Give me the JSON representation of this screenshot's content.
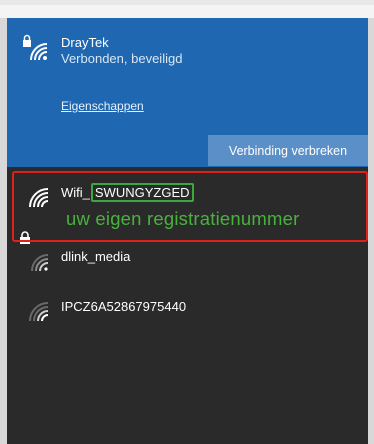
{
  "connected": {
    "ssid": "DrayTek",
    "status": "Verbonden, beveiligd",
    "properties_link": "Eigenschappen",
    "disconnect_button": "Verbinding verbreken",
    "icon": "wifi-secure-icon"
  },
  "networks": [
    {
      "prefix": "Wifi_",
      "ssid_highlight": "SWUNGYZGED",
      "icon": "wifi-icon"
    },
    {
      "name": "dlink_media",
      "icon": "wifi-secure-icon"
    },
    {
      "name": "IPCZ6A52867975440",
      "icon": "wifi-icon"
    }
  ],
  "annotation": {
    "text": "uw eigen registratienummer",
    "color": "#49b23d",
    "box_color": "#e02020"
  },
  "colors": {
    "selected_bg": "#1f67b1",
    "panel_bg": "#2a2a2a",
    "button_bg": "#5b8fc7"
  }
}
